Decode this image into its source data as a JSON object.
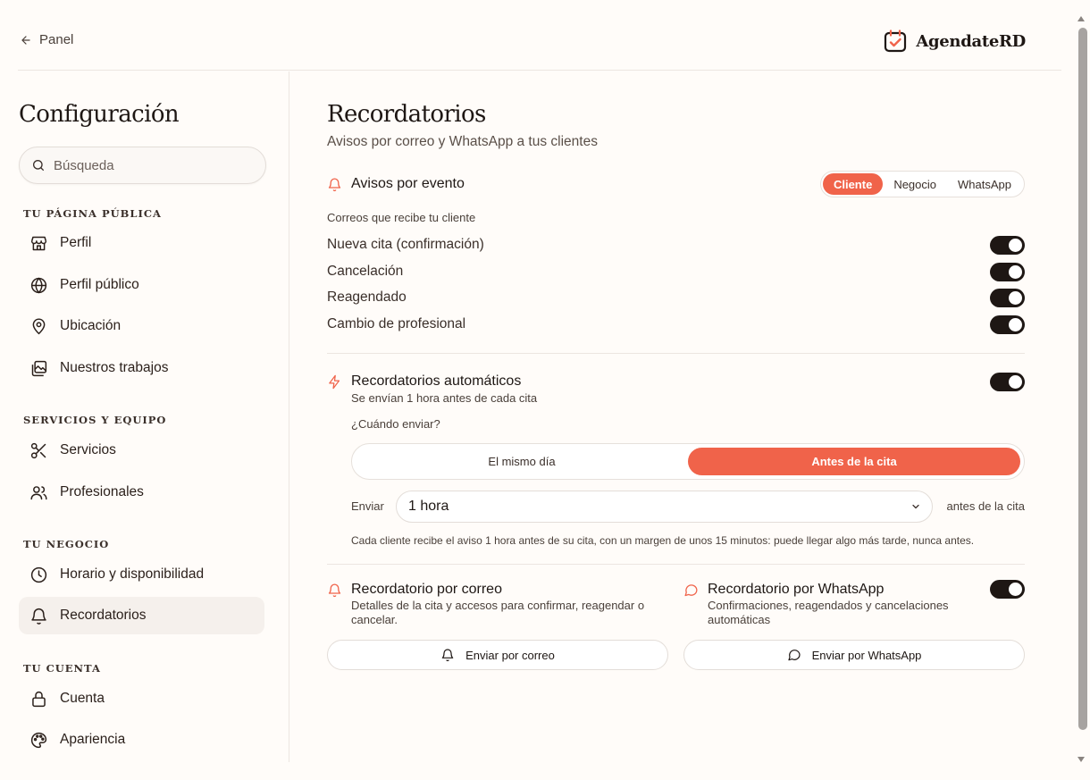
{
  "header": {
    "back_label": "Panel",
    "brand_name": "AgendateRD"
  },
  "sidebar": {
    "title": "Configuración",
    "search_placeholder": "Búsqueda",
    "sections": [
      {
        "heading": "TU PÁGINA PÚBLICA",
        "items": [
          "Perfil",
          "Perfil público",
          "Ubicación",
          "Nuestros trabajos"
        ]
      },
      {
        "heading": "SERVICIOS Y EQUIPO",
        "items": [
          "Servicios",
          "Profesionales"
        ]
      },
      {
        "heading": "TU NEGOCIO",
        "items": [
          "Horario y disponibilidad",
          "Recordatorios"
        ]
      },
      {
        "heading": "TU CUENTA",
        "items": [
          "Cuenta",
          "Apariencia"
        ]
      }
    ],
    "active_item": "Recordatorios"
  },
  "main": {
    "title": "Recordatorios",
    "subtitle": "Avisos por correo y WhatsApp a tus clientes",
    "events": {
      "title": "Avisos por evento",
      "audience_tabs": [
        "Cliente",
        "Negocio",
        "WhatsApp"
      ],
      "selected_tab": "Cliente",
      "list_label": "Correos que recibe tu cliente",
      "toggles": [
        {
          "label": "Nueva cita (confirmación)",
          "on": true
        },
        {
          "label": "Cancelación",
          "on": true
        },
        {
          "label": "Reagendado",
          "on": true
        },
        {
          "label": "Cambio de profesional",
          "on": true
        }
      ]
    },
    "auto": {
      "title": "Recordatorios automáticos",
      "subtitle": "Se envían 1 hora antes de cada cita",
      "enabled": true,
      "when_label": "¿Cuándo enviar?",
      "when_options": [
        "El mismo día",
        "Antes de la cita"
      ],
      "when_selected": "Antes de la cita",
      "send_label": "Enviar",
      "send_value": "1 hora",
      "after_label": "antes de la cita",
      "note": "Cada cliente recibe el aviso 1 hora antes de su cita, con un margen de unos 15 minutos: puede llegar algo más tarde, nunca antes."
    },
    "email_card": {
      "title": "Recordatorio por correo",
      "description": "Detalles de la cita y accesos para confirmar, reagendar o cancelar.",
      "button": "Enviar por correo"
    },
    "whatsapp_card": {
      "title": "Recordatorio por WhatsApp",
      "description": "Confirmaciones, reagendados y cancelaciones automáticas",
      "enabled": true,
      "button": "Enviar por WhatsApp"
    }
  },
  "colors": {
    "accent": "#f0634a",
    "toggle_on": "#1e1714",
    "background": "#fffcf9"
  }
}
